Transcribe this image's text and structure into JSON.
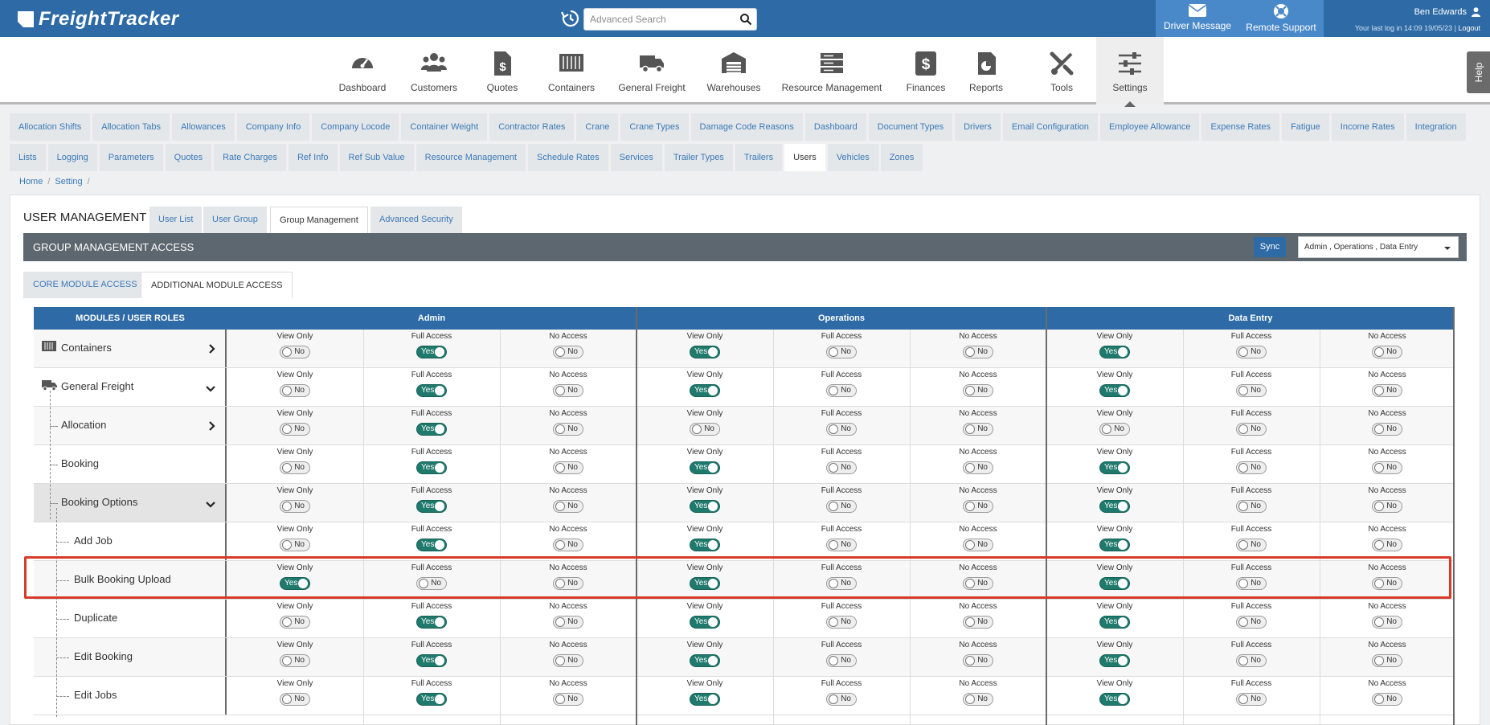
{
  "brand": {
    "logo_text": "FreightTracker"
  },
  "search": {
    "placeholder": "Advanced Search",
    "value": ""
  },
  "top_actions": {
    "driver_message": "Driver Message",
    "remote_support": "Remote Support"
  },
  "user": {
    "name": "Ben Edwards",
    "last_login": "Your last log in 14:09 19/05/23 |",
    "logout": "Logout"
  },
  "nav": {
    "items": [
      {
        "label": "Dashboard",
        "icon": "speedometer-icon"
      },
      {
        "label": "Customers",
        "icon": "users-icon"
      },
      {
        "label": "Quotes",
        "icon": "quote-dollar-icon"
      },
      {
        "label": "Containers",
        "icon": "container-icon"
      },
      {
        "label": "General Freight",
        "icon": "truck-icon"
      },
      {
        "label": "Warehouses",
        "icon": "warehouse-icon"
      },
      {
        "label": "Resource Management",
        "icon": "server-icon"
      },
      {
        "label": "Finances",
        "icon": "dollar-icon"
      },
      {
        "label": "Reports",
        "icon": "report-icon"
      },
      {
        "label": "Tools",
        "icon": "tools-icon"
      },
      {
        "label": "Settings",
        "icon": "sliders-icon",
        "active": true
      }
    ]
  },
  "help": {
    "label": "Help"
  },
  "settings_tabs": {
    "row1": [
      "Allocation Shifts",
      "Allocation Tabs",
      "Allowances",
      "Company Info",
      "Company Locode",
      "Container Weight",
      "Contractor Rates",
      "Crane",
      "Crane Types",
      "Damage Code Reasons",
      "Dashboard",
      "Document Types",
      "Drivers",
      "Email Configuration",
      "Employee Allowance",
      "Expense Rates",
      "Fatigue",
      "Income Rates",
      "Integration"
    ],
    "row2": [
      "Lists",
      "Logging",
      "Parameters",
      "Quotes",
      "Rate Charges",
      "Ref Info",
      "Ref Sub Value",
      "Resource Management",
      "Schedule Rates",
      "Services",
      "Trailer Types",
      "Trailers",
      "Users",
      "Vehicles",
      "Zones"
    ],
    "active": "Users"
  },
  "breadcrumb": {
    "home": "Home",
    "setting": "Setting"
  },
  "user_management": {
    "title": "USER MANAGEMENT",
    "tabs": [
      "User List",
      "User Group",
      "Group Management",
      "Advanced Security"
    ],
    "active_tab": "Group Management"
  },
  "group_management": {
    "title": "GROUP MANAGEMENT ACCESS",
    "sync_label": "Sync",
    "selected_roles": "Admin , Operations , Data Entry",
    "access_tabs": [
      "CORE MODULE ACCESS",
      "ADDITIONAL MODULE ACCESS"
    ],
    "active_access_tab": "ADDITIONAL MODULE ACCESS"
  },
  "grid": {
    "modules_header": "MODULES / USER ROLES",
    "roles": [
      "Admin",
      "Operations",
      "Data Entry"
    ],
    "perm_labels": [
      "View Only",
      "Full Access",
      "No Access"
    ],
    "toggle_yes": "Yes",
    "toggle_no": "No",
    "rows": [
      {
        "name": "Containers",
        "values": [
          [
            false,
            true,
            false
          ],
          [
            true,
            false,
            false
          ],
          [
            true,
            false,
            false
          ]
        ]
      },
      {
        "name": "General Freight",
        "values": [
          [
            false,
            true,
            false
          ],
          [
            true,
            false,
            false
          ],
          [
            true,
            false,
            false
          ]
        ]
      },
      {
        "name": "Allocation",
        "values": [
          [
            false,
            true,
            false
          ],
          [
            false,
            false,
            false
          ],
          [
            false,
            false,
            false
          ]
        ]
      },
      {
        "name": "Booking",
        "values": [
          [
            false,
            true,
            false
          ],
          [
            true,
            false,
            false
          ],
          [
            true,
            false,
            false
          ]
        ]
      },
      {
        "name": "Booking Options",
        "values": [
          [
            false,
            true,
            false
          ],
          [
            true,
            false,
            false
          ],
          [
            true,
            false,
            false
          ]
        ]
      },
      {
        "name": "Add Job",
        "values": [
          [
            false,
            true,
            false
          ],
          [
            true,
            false,
            false
          ],
          [
            true,
            false,
            false
          ]
        ]
      },
      {
        "name": "Bulk Booking Upload",
        "values": [
          [
            true,
            false,
            false
          ],
          [
            true,
            false,
            false
          ],
          [
            true,
            false,
            false
          ]
        ]
      },
      {
        "name": "Duplicate",
        "values": [
          [
            false,
            true,
            false
          ],
          [
            true,
            false,
            false
          ],
          [
            true,
            false,
            false
          ]
        ]
      },
      {
        "name": "Edit Booking",
        "values": [
          [
            false,
            true,
            false
          ],
          [
            true,
            false,
            false
          ],
          [
            true,
            false,
            false
          ]
        ]
      },
      {
        "name": "Edit Jobs",
        "values": [
          [
            false,
            true,
            false
          ],
          [
            true,
            false,
            false
          ],
          [
            true,
            false,
            false
          ]
        ]
      }
    ]
  },
  "colors": {
    "brand_blue": "#2d6aa6",
    "toggle_on": "#1f7a6d",
    "highlight": "#d63a2a"
  }
}
